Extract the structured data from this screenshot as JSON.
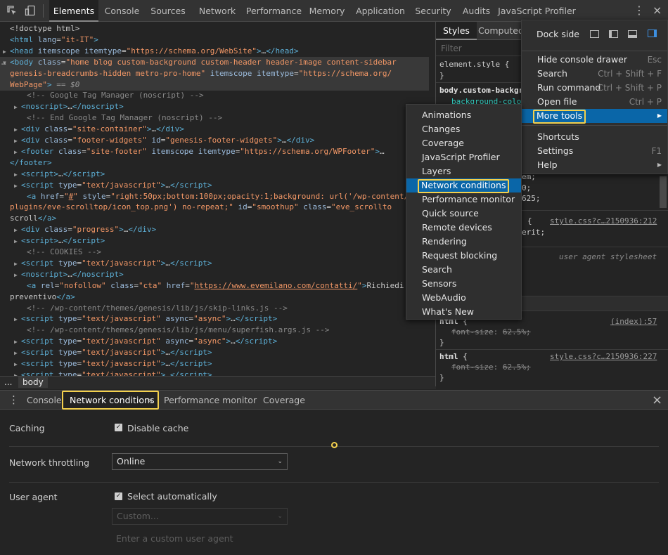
{
  "toolbar": {
    "tabs": [
      "Elements",
      "Console",
      "Sources",
      "Network",
      "Performance",
      "Memory",
      "Application",
      "Security",
      "Audits",
      "JavaScript Profiler"
    ]
  },
  "elements": {
    "lines": [
      {
        "ind": 0,
        "t": "",
        "html": "<span class='cm' style='color:#c9c9c9'>&lt;!doctype html&gt;</span>"
      },
      {
        "ind": 0,
        "t": "",
        "html": "<span class='tag'>&lt;html</span> <span class='an'>lang</span>=<span class='av'>\"it-IT\"</span><span class='tag'>&gt;</span>"
      },
      {
        "ind": 0,
        "t": "▶",
        "html": "<span class='tag'>&lt;head</span> <span class='an'>itemscope</span> <span class='an'>itemtype</span>=<span class='av'>\"https://schema.org/WebSite\"</span><span class='tag'>&gt;</span>…<span class='tag'>&lt;/head&gt;</span>"
      },
      {
        "ind": 0,
        "t": "▼",
        "sel": true,
        "html": "<span class='tag'>&lt;body</span> <span class='an'>class</span>=<span class='av'>\"home blog custom-background custom-header header-image content-sidebar</span>"
      },
      {
        "ind": 0,
        "sel": true,
        "html": "<span class='av'>genesis-breadcrumbs-hidden metro-pro-home\"</span> <span class='an'>itemscope</span> <span class='an'>itemtype</span>=<span class='av'>\"https://schema.org/</span>"
      },
      {
        "ind": 0,
        "sel": true,
        "html": "<span class='av'>WebPage\"</span><span class='tag'>&gt;</span> <span class='dollar'>== $0</span>"
      },
      {
        "ind": 2,
        "html": "<span class='cm'>&lt;!-- Google Tag Manager (noscript) --&gt;</span>"
      },
      {
        "ind": 1,
        "t": "▶",
        "html": "<span class='tag'>&lt;noscript&gt;</span>…<span class='tag'>&lt;/noscript&gt;</span>"
      },
      {
        "ind": 2,
        "html": "<span class='cm'>&lt;!-- End Google Tag Manager (noscript) --&gt;</span>"
      },
      {
        "ind": 1,
        "t": "▶",
        "html": "<span class='tag'>&lt;div</span> <span class='an'>class</span>=<span class='av'>\"site-container\"</span><span class='tag'>&gt;</span>…<span class='tag'>&lt;/div&gt;</span>"
      },
      {
        "ind": 1,
        "t": "▶",
        "html": "<span class='tag'>&lt;div</span> <span class='an'>class</span>=<span class='av'>\"footer-widgets\"</span> <span class='an'>id</span>=<span class='av'>\"genesis-footer-widgets\"</span><span class='tag'>&gt;</span>…<span class='tag'>&lt;/div&gt;</span>"
      },
      {
        "ind": 1,
        "t": "▶",
        "html": "<span class='tag'>&lt;footer</span> <span class='an'>class</span>=<span class='av'>\"site-footer\"</span> <span class='an'>itemscope</span> <span class='an'>itemtype</span>=<span class='av'>\"https://schema.org/WPFooter\"</span><span class='tag'>&gt;</span>…"
      },
      {
        "ind": 0,
        "html": "<span class='tag'>&lt;/footer&gt;</span>"
      },
      {
        "ind": 1,
        "t": "▶",
        "html": "<span class='tag'>&lt;script&gt;</span>…<span class='tag'>&lt;/script&gt;</span>"
      },
      {
        "ind": 1,
        "t": "▶",
        "html": "<span class='tag'>&lt;script</span> <span class='an'>type</span>=<span class='av'>\"text/javascript\"</span><span class='tag'>&gt;</span>…<span class='tag'>&lt;/script&gt;</span>"
      },
      {
        "ind": 2,
        "html": "<span class='tag'>&lt;a</span> <span class='an'>href</span>=<span class='av'>\"<u>#</u>\"</span> <span class='an'>style</span>=<span class='av'>\"right:50px;bottom:100px;opacity:1;background: url('/wp-content/</span>"
      },
      {
        "ind": 0,
        "html": "<span class='av'>plugins/eve-scrolltop/icon_top.png') no-repeat;\"</span> <span class='an'>id</span>=<span class='av'>\"smoothup\"</span> <span class='an'>class</span>=<span class='av'>\"eve_scrollto</span>"
      },
      {
        "ind": 0,
        "html": "scroll<span class='tag'>&lt;/a&gt;</span>"
      },
      {
        "ind": 1,
        "t": "▶",
        "html": "<span class='tag'>&lt;div</span> <span class='an'>class</span>=<span class='av'>\"progress\"</span><span class='tag'>&gt;</span>…<span class='tag'>&lt;/div&gt;</span>"
      },
      {
        "ind": 1,
        "t": "▶",
        "html": "<span class='tag'>&lt;script&gt;</span>…<span class='tag'>&lt;/script&gt;</span>"
      },
      {
        "ind": 2,
        "html": "<span class='cm'>&lt;!-- COOKIES --&gt;</span>"
      },
      {
        "ind": 1,
        "t": "▶",
        "html": "<span class='tag'>&lt;script</span> <span class='an'>type</span>=<span class='av'>\"text/javascript\"</span><span class='tag'>&gt;</span>…<span class='tag'>&lt;/script&gt;</span>"
      },
      {
        "ind": 1,
        "t": "▶",
        "html": "<span class='tag'>&lt;noscript&gt;</span>…<span class='tag'>&lt;/noscript&gt;</span>"
      },
      {
        "ind": 2,
        "html": "<span class='tag'>&lt;a</span> <span class='an'>rel</span>=<span class='av'>\"nofollow\"</span> <span class='an'>class</span>=<span class='av'>\"cta\"</span> <span class='an'>href</span>=<span class='av'>\"<u>https://www.evemilano.com/contatti/</u>\"</span><span class='tag'>&gt;</span>Richiedi"
      },
      {
        "ind": 0,
        "html": "preventivo<span class='tag'>&lt;/a&gt;</span>"
      },
      {
        "ind": 2,
        "html": "<span class='cm'>&lt;!-- /wp-content/themes/genesis/lib/js/skip-links.js --&gt;</span>"
      },
      {
        "ind": 1,
        "t": "▶",
        "html": "<span class='tag'>&lt;script</span> <span class='an'>type</span>=<span class='av'>\"text/javascript\"</span> <span class='an'>async</span>=<span class='av'>\"async\"</span><span class='tag'>&gt;</span>…<span class='tag'>&lt;/script&gt;</span>"
      },
      {
        "ind": 2,
        "html": "<span class='cm'>&lt;!-- /wp-content/themes/genesis/lib/js/menu/superfish.args.js --&gt;</span>"
      },
      {
        "ind": 1,
        "t": "▶",
        "html": "<span class='tag'>&lt;script</span> <span class='an'>type</span>=<span class='av'>\"text/javascript\"</span> <span class='an'>async</span>=<span class='av'>\"async\"</span><span class='tag'>&gt;</span>…<span class='tag'>&lt;/script&gt;</span>"
      },
      {
        "ind": 1,
        "t": "▶",
        "html": "<span class='tag'>&lt;script</span> <span class='an'>type</span>=<span class='av'>\"text/javascript\"</span><span class='tag'>&gt;</span>…<span class='tag'>&lt;/script&gt;</span>"
      },
      {
        "ind": 1,
        "t": "▶",
        "html": "<span class='tag'>&lt;script</span> <span class='an'>type</span>=<span class='av'>\"text/javascript\"</span><span class='tag'>&gt;</span>…<span class='tag'>&lt;/script&gt;</span>"
      },
      {
        "ind": 1,
        "t": "▶",
        "html": "<span class='tag'>&lt;script</span> <span class='an'>type</span>=<span class='av'>\"text/javascript\"</span><span class='tag'>&gt;</span>…<span class='tag'>&lt;/script&gt;</span>"
      }
    ]
  },
  "breadcrumb": {
    "ellipsis": "...",
    "node": "body"
  },
  "styles": {
    "tabs": [
      "Styles",
      "Computed"
    ],
    "filter_placeholder": "Filter",
    "element_style": "element.style {",
    "close_brace": "}",
    "rule1_selector": "body.custom-backgr",
    "rule1_prop": "background-colo",
    "frag1": "em;",
    "frag2": "0;",
    "frag3": "625;",
    "brace_open": "{",
    "link1": "style.css?c…2150936:212",
    "frag_inherit": "erit;",
    "ua_stylesheet": "user agent stylesheet",
    "html_sel": "html",
    "font_size_prop": "font-size",
    "font_size_val": "62.5%;",
    "link2": "(index):57",
    "link3": "style.css?c…2150936:227"
  },
  "main_menu": {
    "dock_side": "Dock side",
    "items": [
      {
        "label": "Hide console drawer",
        "shortcut": "Esc"
      },
      {
        "label": "Search",
        "shortcut": "Ctrl + Shift + F"
      },
      {
        "label": "Run command",
        "shortcut": "Ctrl + Shift + P"
      },
      {
        "label": "Open file",
        "shortcut": "Ctrl + P"
      },
      {
        "label": "More tools",
        "shortcut": "▶"
      },
      {
        "label": "Shortcuts",
        "shortcut": ""
      },
      {
        "label": "Settings",
        "shortcut": "F1"
      },
      {
        "label": "Help",
        "shortcut": "▶"
      }
    ]
  },
  "more_tools": {
    "items": [
      "Animations",
      "Changes",
      "Coverage",
      "JavaScript Profiler",
      "Layers",
      "Network conditions",
      "Performance monitor",
      "Quick source",
      "Remote devices",
      "Rendering",
      "Request blocking",
      "Search",
      "Sensors",
      "WebAudio",
      "What's New"
    ]
  },
  "drawer": {
    "tabs": [
      {
        "label": "Console"
      },
      {
        "label": "Network conditions",
        "close": "×"
      },
      {
        "label": "Performance monitor"
      },
      {
        "label": "Coverage"
      }
    ],
    "close_icon": "×"
  },
  "network_conditions": {
    "caching_label": "Caching",
    "disable_cache_label": "Disable cache",
    "disable_cache_checked": true,
    "throttling_label": "Network throttling",
    "throttling_value": "Online",
    "user_agent_label": "User agent",
    "select_auto_label": "Select automatically",
    "select_auto_checked": true,
    "custom_value": "Custom...",
    "custom_ua_placeholder": "Enter a custom user agent"
  },
  "colors": {
    "accent": "#f3d04d",
    "hover": "#0a66a8"
  }
}
